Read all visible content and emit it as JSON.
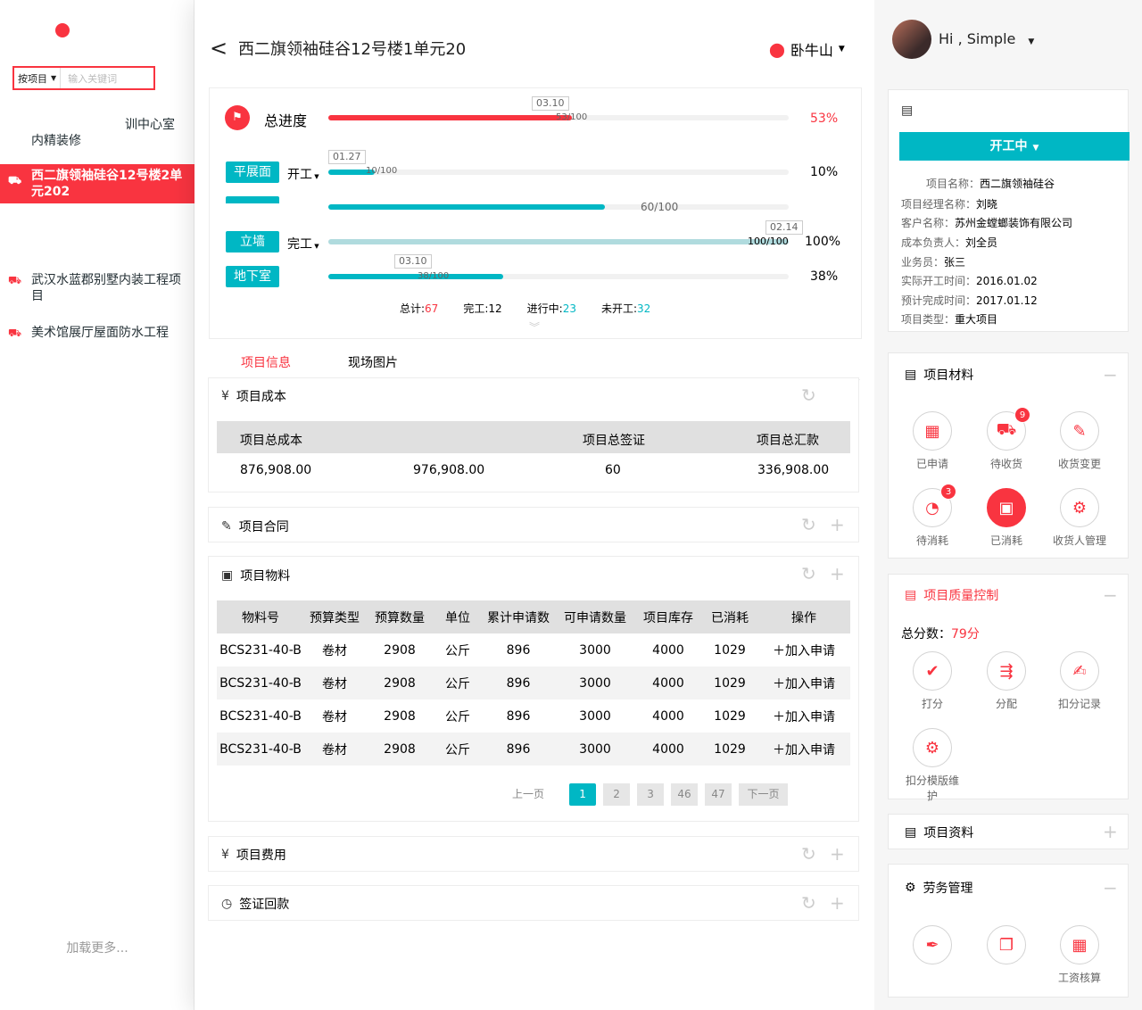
{
  "header": {
    "title": "西二旗领袖硅谷12号楼1单元20",
    "back_glyph": "<",
    "location": "卧牛山",
    "user_greeting": "Hi , Simple"
  },
  "left_nav": {
    "search_scope": "按项目",
    "search_placeholder": "输入关键词",
    "partial_items": [
      "训中心室",
      "内精装修"
    ],
    "active_item": "西二旗领袖硅谷12号楼2单元202",
    "items": [
      "武汉水蓝郡别墅内装工程项目",
      "美术馆展厅屋面防水工程"
    ],
    "load_more": "加载更多..."
  },
  "progress": {
    "total_label": "总进度",
    "total_date": "03.10",
    "total_ratio": "53/100",
    "total_pct": "53%",
    "total_value": 0.53,
    "stages": [
      {
        "name": "平展面",
        "status": "开工",
        "date": "01.27",
        "ratio": "10/100",
        "pct": "10%",
        "value": 0.1
      },
      {
        "name": "",
        "status": "",
        "date": "",
        "ratio": "60/100",
        "pct": "",
        "value": 0.6
      },
      {
        "name": "立墙",
        "status": "完工",
        "date": "02.14",
        "ratio": "100/100",
        "pct": "100%",
        "value": 1.0
      },
      {
        "name": "地下室",
        "status": "",
        "date": "03.10",
        "ratio": "38/100",
        "pct": "38%",
        "value": 0.38
      }
    ],
    "stats": {
      "total_label": "总计:",
      "total": "67",
      "done_label": "完工:",
      "done": "12",
      "doing_label": "进行中:",
      "doing": "23",
      "notstarted_label": "未开工:",
      "notstarted": "32"
    }
  },
  "tabs": [
    "项目信息",
    "现场图片"
  ],
  "cost": {
    "title": "项目成本",
    "headers": [
      "项目总成本",
      "",
      "项目总签证",
      "项目总汇款"
    ],
    "values": [
      "876,908.00",
      "976,908.00",
      "60",
      "336,908.00"
    ]
  },
  "contract": {
    "title": "项目合同"
  },
  "materials": {
    "title": "项目物料",
    "headers": [
      "物料号",
      "预算类型",
      "预算数量",
      "单位",
      "累计申请数",
      "可申请数量",
      "项目库存",
      "已消耗",
      "操作"
    ],
    "rows": [
      [
        "BCS231-40-B",
        "卷材",
        "2908",
        "公斤",
        "896",
        "3000",
        "4000",
        "1029",
        "加入申请"
      ],
      [
        "BCS231-40-B",
        "卷材",
        "2908",
        "公斤",
        "896",
        "3000",
        "4000",
        "1029",
        "加入申请"
      ],
      [
        "BCS231-40-B",
        "卷材",
        "2908",
        "公斤",
        "896",
        "3000",
        "4000",
        "1029",
        "加入申请"
      ],
      [
        "BCS231-40-B",
        "卷材",
        "2908",
        "公斤",
        "896",
        "3000",
        "4000",
        "1029",
        "加入申请"
      ]
    ],
    "pager": {
      "prev": "上一页",
      "pages": [
        "1",
        "2",
        "3",
        "46",
        "47"
      ],
      "next": "下一页"
    }
  },
  "fees": {
    "title": "项目费用"
  },
  "visa": {
    "title": "签证回款"
  },
  "right": {
    "status": "开工中",
    "info": [
      {
        "label": "项目名称：",
        "value": "西二旗领袖硅谷"
      },
      {
        "label": "项目经理名称：",
        "value": "刘晓"
      },
      {
        "label": "客户名称：",
        "value": "苏州金螳螂装饰有限公司"
      },
      {
        "label": "成本负责人：",
        "value": "刘全员"
      },
      {
        "label": "业务员：",
        "value": "张三"
      },
      {
        "label": "实际开工时间：",
        "value": "2016.01.02"
      },
      {
        "label": "预计完成时间：",
        "value": "2017.01.12"
      },
      {
        "label": "项目类型：",
        "value": "重大项目"
      }
    ],
    "materials_title": "项目材料",
    "materials_btns": [
      {
        "label": "已申请",
        "badge": ""
      },
      {
        "label": "待收货",
        "badge": "9"
      },
      {
        "label": "收货变更",
        "badge": ""
      },
      {
        "label": "待消耗",
        "badge": "3"
      },
      {
        "label": "已消耗",
        "badge": ""
      },
      {
        "label": "收货人管理",
        "badge": ""
      }
    ],
    "quality_title": "项目质量控制",
    "score_label": "总分数：",
    "score": "79分",
    "quality_btns": [
      "打分",
      "分配",
      "扣分记录",
      "扣分模版维护"
    ],
    "docs_title": "项目资料",
    "labor_title": "劳务管理",
    "labor_btns": [
      "",
      "",
      "工资核算"
    ]
  },
  "colors": {
    "brand": "#F93440",
    "accent": "#00B7C4"
  }
}
